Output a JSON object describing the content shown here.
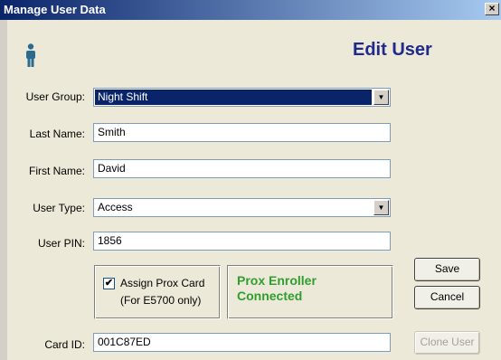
{
  "window": {
    "title": "Manage User Data",
    "close_glyph": "×"
  },
  "heading": "Edit User",
  "icons": {
    "user_icon": "person-icon",
    "dropdown": "chevron-down-icon"
  },
  "form": {
    "user_group": {
      "label": "User Group:",
      "value": "Night Shift"
    },
    "last_name": {
      "label": "Last Name:",
      "value": "Smith"
    },
    "first_name": {
      "label": "First Name:",
      "value": "David"
    },
    "user_type": {
      "label": "User Type:",
      "value": "Access"
    },
    "user_pin": {
      "label": "User PIN:",
      "value": "1856"
    },
    "card_id": {
      "label": "Card ID:",
      "value": "001C87ED"
    }
  },
  "prox": {
    "assign_label": "Assign Prox Card",
    "assign_note": "(For E5700 only)",
    "assign_checked": true,
    "status_line1": "Prox Enroller",
    "status_line2": "Connected"
  },
  "buttons": {
    "save": "Save",
    "cancel": "Cancel",
    "clone": "Clone User"
  },
  "colors": {
    "heading": "#1f2a8c",
    "status": "#2f9e2f",
    "titlebar": "#0a246a"
  }
}
